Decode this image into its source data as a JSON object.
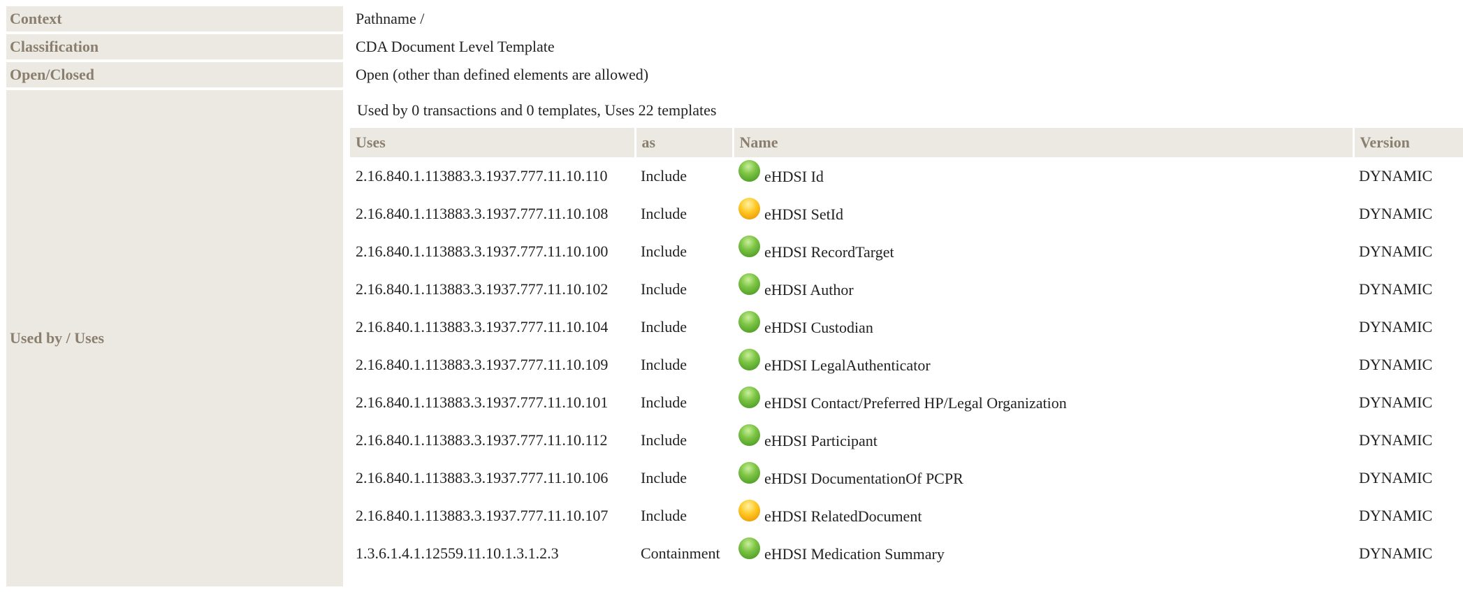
{
  "properties": {
    "context": {
      "label": "Context",
      "value": "Pathname /"
    },
    "classification": {
      "label": "Classification",
      "value": "CDA Document Level Template"
    },
    "open_closed": {
      "label": "Open/Closed",
      "value": "Open (other than defined elements are allowed)"
    },
    "used_by_uses": {
      "label": "Used by / Uses"
    }
  },
  "usage": {
    "summary": "Used by 0 transactions and 0 templates, Uses 22 templates",
    "columns": {
      "uses": "Uses",
      "as": "as",
      "name": "Name",
      "version": "Version"
    },
    "status_colors": {
      "active": "#6cbf3a",
      "draft": "#ffc21a"
    },
    "rows": [
      {
        "uses": "2.16.840.1.113883.3.1937.777.11.10.110",
        "as": "Include",
        "status": "active",
        "status_icon": "green-status-dot-icon",
        "name": "eHDSI Id",
        "version": "DYNAMIC"
      },
      {
        "uses": "2.16.840.1.113883.3.1937.777.11.10.108",
        "as": "Include",
        "status": "draft",
        "status_icon": "yellow-status-dot-icon",
        "name": "eHDSI SetId",
        "version": "DYNAMIC"
      },
      {
        "uses": "2.16.840.1.113883.3.1937.777.11.10.100",
        "as": "Include",
        "status": "active",
        "status_icon": "green-status-dot-icon",
        "name": "eHDSI RecordTarget",
        "version": "DYNAMIC"
      },
      {
        "uses": "2.16.840.1.113883.3.1937.777.11.10.102",
        "as": "Include",
        "status": "active",
        "status_icon": "green-status-dot-icon",
        "name": "eHDSI Author",
        "version": "DYNAMIC"
      },
      {
        "uses": "2.16.840.1.113883.3.1937.777.11.10.104",
        "as": "Include",
        "status": "active",
        "status_icon": "green-status-dot-icon",
        "name": "eHDSI Custodian",
        "version": "DYNAMIC"
      },
      {
        "uses": "2.16.840.1.113883.3.1937.777.11.10.109",
        "as": "Include",
        "status": "active",
        "status_icon": "green-status-dot-icon",
        "name": "eHDSI LegalAuthenticator",
        "version": "DYNAMIC"
      },
      {
        "uses": "2.16.840.1.113883.3.1937.777.11.10.101",
        "as": "Include",
        "status": "active",
        "status_icon": "green-status-dot-icon",
        "name": "eHDSI Contact/Preferred HP/Legal Organization",
        "version": "DYNAMIC"
      },
      {
        "uses": "2.16.840.1.113883.3.1937.777.11.10.112",
        "as": "Include",
        "status": "active",
        "status_icon": "green-status-dot-icon",
        "name": "eHDSI Participant",
        "version": "DYNAMIC"
      },
      {
        "uses": "2.16.840.1.113883.3.1937.777.11.10.106",
        "as": "Include",
        "status": "active",
        "status_icon": "green-status-dot-icon",
        "name": "eHDSI DocumentationOf PCPR",
        "version": "DYNAMIC"
      },
      {
        "uses": "2.16.840.1.113883.3.1937.777.11.10.107",
        "as": "Include",
        "status": "draft",
        "status_icon": "yellow-status-dot-icon",
        "name": "eHDSI RelatedDocument",
        "version": "DYNAMIC"
      },
      {
        "uses": "1.3.6.1.4.1.12559.11.10.1.3.1.2.3",
        "as": "Containment",
        "status": "active",
        "status_icon": "green-status-dot-icon",
        "name": "eHDSI Medication Summary",
        "version": "DYNAMIC"
      }
    ]
  }
}
